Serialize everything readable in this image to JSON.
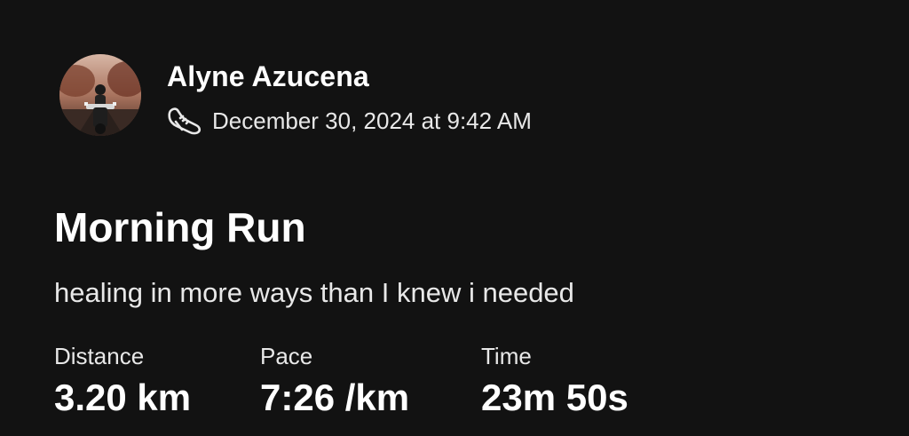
{
  "athlete": {
    "name": "Alyne Azucena",
    "activity_icon": "running-shoe-icon",
    "timestamp": "December 30, 2024 at 9:42 AM"
  },
  "activity": {
    "title": "Morning Run",
    "description": "healing in more ways than I knew i needed"
  },
  "stats": {
    "distance": {
      "label": "Distance",
      "value": "3.20 km"
    },
    "pace": {
      "label": "Pace",
      "value": "7:26 /km"
    },
    "time": {
      "label": "Time",
      "value": "23m 50s"
    }
  },
  "colors": {
    "background": "#121212",
    "primary_text": "#ffffff",
    "secondary_text": "#e8e8e8"
  }
}
